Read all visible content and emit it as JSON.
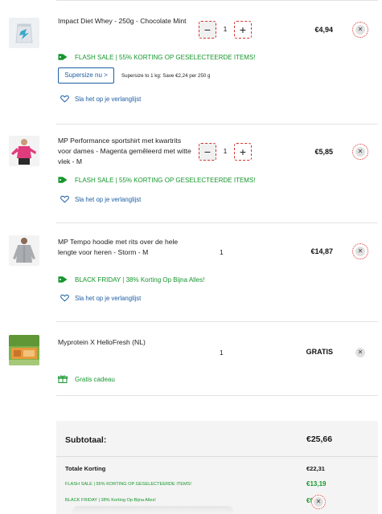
{
  "cart": {
    "items": [
      {
        "title": "Impact Diet Whey - 250g - Chocolate Mint",
        "qty": "1",
        "price": "€4,94",
        "promo": "FLASH SALE | 55% KORTING OP GESELECTEERDE ITEMS!",
        "supersize_label": "Supersize nu >",
        "supersize_note": "Supersize to 1 kg: Save €2,24 per 250 g",
        "wishlist": "Sla het op je verlanglijst",
        "image": "whey-pouch-image"
      },
      {
        "title": "MP Performance sportshirt met kwartrits voor dames - Magenta gemêleerd met witte vlek - M",
        "qty": "1",
        "price": "€5,85",
        "promo": "FLASH SALE | 55% KORTING OP GESELECTEERDE ITEMS!",
        "wishlist": "Sla het op je verlanglijst",
        "image": "magenta-top-image"
      },
      {
        "title": "MP Tempo hoodie met rits over de hele lengte voor heren - Storm - M",
        "qty": "1",
        "price": "€14,87",
        "promo": "BLACK FRIDAY | 38% Korting Op Bijna Alles!",
        "wishlist": "Sla het op je verlanglijst",
        "image": "grey-hoodie-image"
      },
      {
        "title": "Myprotein X HelloFresh (NL)",
        "qty": "1",
        "price": "GRATIS",
        "promo": "Gratis cadeau",
        "image": "hellofresh-box-image"
      }
    ]
  },
  "summary": {
    "subtotal_label": "Subtotaal:",
    "subtotal_value": "€25,66",
    "discount_label": "Totale Korting",
    "discount_total": "€22,31",
    "discounts": [
      {
        "label": "FLASH SALE | 55% KORTING OP GESELECTEERDE ITEMS!",
        "value": "€13,19"
      },
      {
        "label": "BLACK FRIDAY | 38% Korting Op Bijna Alles!",
        "value": "€9,12"
      }
    ]
  },
  "colors": {
    "promo_green": "#16962c",
    "link_blue": "#1f5fa3",
    "highlight_red": "#d6332c"
  },
  "icons": {
    "remove": "close-icon",
    "promo": "tag-icon",
    "wishlist": "heart-icon",
    "gift": "gift-icon"
  }
}
